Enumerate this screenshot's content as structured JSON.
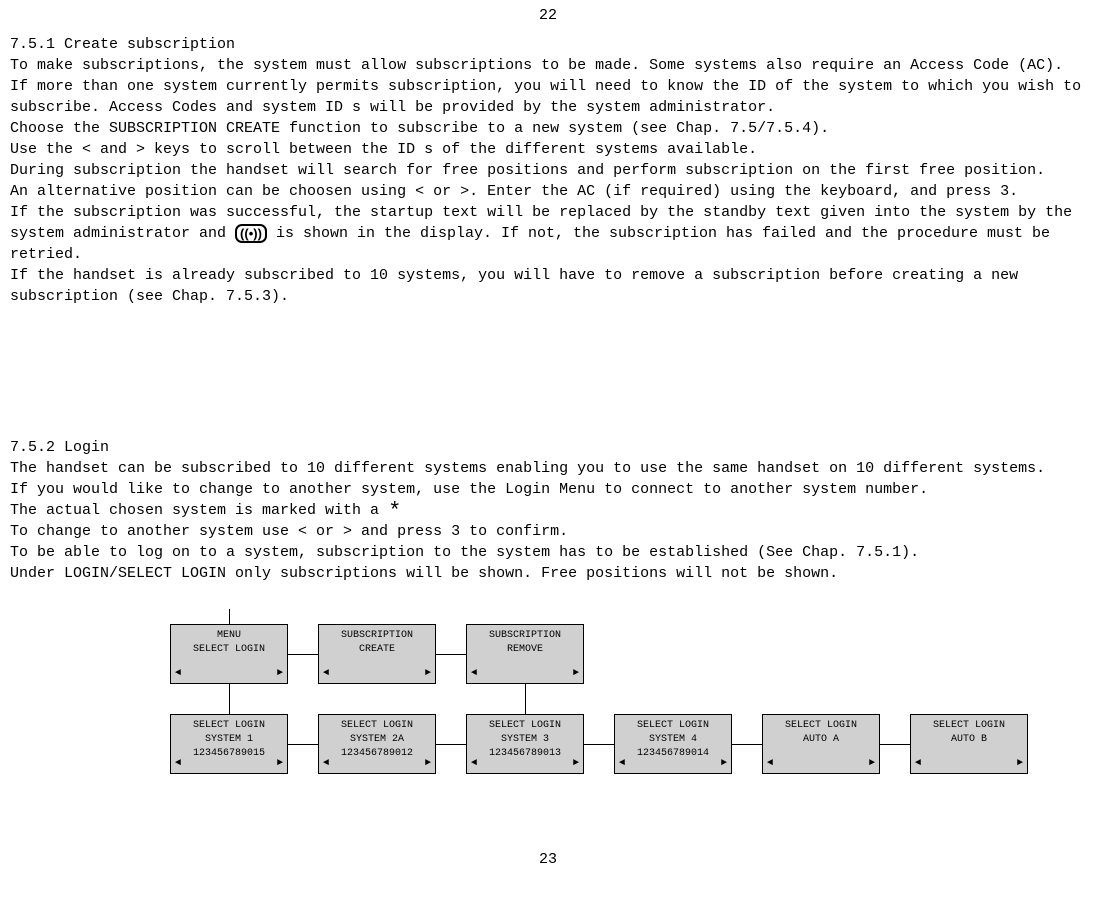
{
  "page_num_top": "22",
  "page_num_bottom": "23",
  "s1": {
    "title": "7.5.1 Create subscription",
    "p1": "To make subscriptions, the system must allow subscriptions to be made. Some systems also require an Access Code (AC). If more than one system currently permits subscription, you will need to know the ID of the system to which you wish to subscribe. Access Codes and system ID s will be provided by the system administrator.",
    "p2": "Choose the  SUBSCRIPTION CREATE  function to subscribe to a new system (see Chap. 7.5/7.5.4).",
    "p3": "Use the < and > keys to scroll between the ID s of the different systems available.",
    "p4": "During subscription the handset will search for free positions and perform subscription on the first free position.",
    "p5": "An alternative position can be choosen using < or >. Enter the AC (if required) using the keyboard, and press  3.",
    "p6a": "If the subscription was successful, the startup text will be replaced by the standby text given into the system by the system administrator and ",
    "p6b": " is shown in the display. If not, the subscription has failed and the procedure must be retried.",
    "p7": "If the handset is already subscribed to 10 systems, you will have to remove a subscription before creating a new subscription (see Chap. 7.5.3)."
  },
  "signal_glyph": "((•))",
  "s2": {
    "title": "7.5.2 Login",
    "p1": "The handset can be subscribed to 10 different systems enabling you to use the same handset on 10 different systems.",
    "p2": "If you would like to change to another system, use the Login Menu to connect to another system number.",
    "p3a": "The actual chosen system is marked with a ",
    "p4": "To change to another system use < or > and press  3 to confirm.",
    "p5": "To be able to log on to a system, subscription to the system has to be established (See Chap. 7.5.1).",
    "p6": "Under LOGIN/SELECT LOGIN only subscriptions will be shown. Free positions will not be shown."
  },
  "star": "*",
  "arrow_left": "◄",
  "arrow_right": "►",
  "screens": {
    "menu": {
      "l1": "MENU",
      "l2": "SELECT LOGIN",
      "l3": ""
    },
    "create": {
      "l1": "SUBSCRIPTION",
      "l2": "CREATE",
      "l3": ""
    },
    "remove": {
      "l1": "SUBSCRIPTION",
      "l2": "REMOVE",
      "l3": ""
    },
    "sys1": {
      "l1": "SELECT LOGIN",
      "l2": "SYSTEM 1",
      "l3": "123456789015"
    },
    "sys2a": {
      "l1": "SELECT LOGIN",
      "l2": "SYSTEM 2A",
      "l3": "123456789012"
    },
    "sys3": {
      "l1": "SELECT LOGIN",
      "l2": "SYSTEM 3",
      "l3": "123456789013"
    },
    "sys4": {
      "l1": "SELECT LOGIN",
      "l2": "SYSTEM 4",
      "l3": "123456789014"
    },
    "autoa": {
      "l1": "SELECT LOGIN",
      "l2": "AUTO A",
      "l3": ""
    },
    "autob": {
      "l1": "SELECT LOGIN",
      "l2": "AUTO B",
      "l3": ""
    }
  }
}
